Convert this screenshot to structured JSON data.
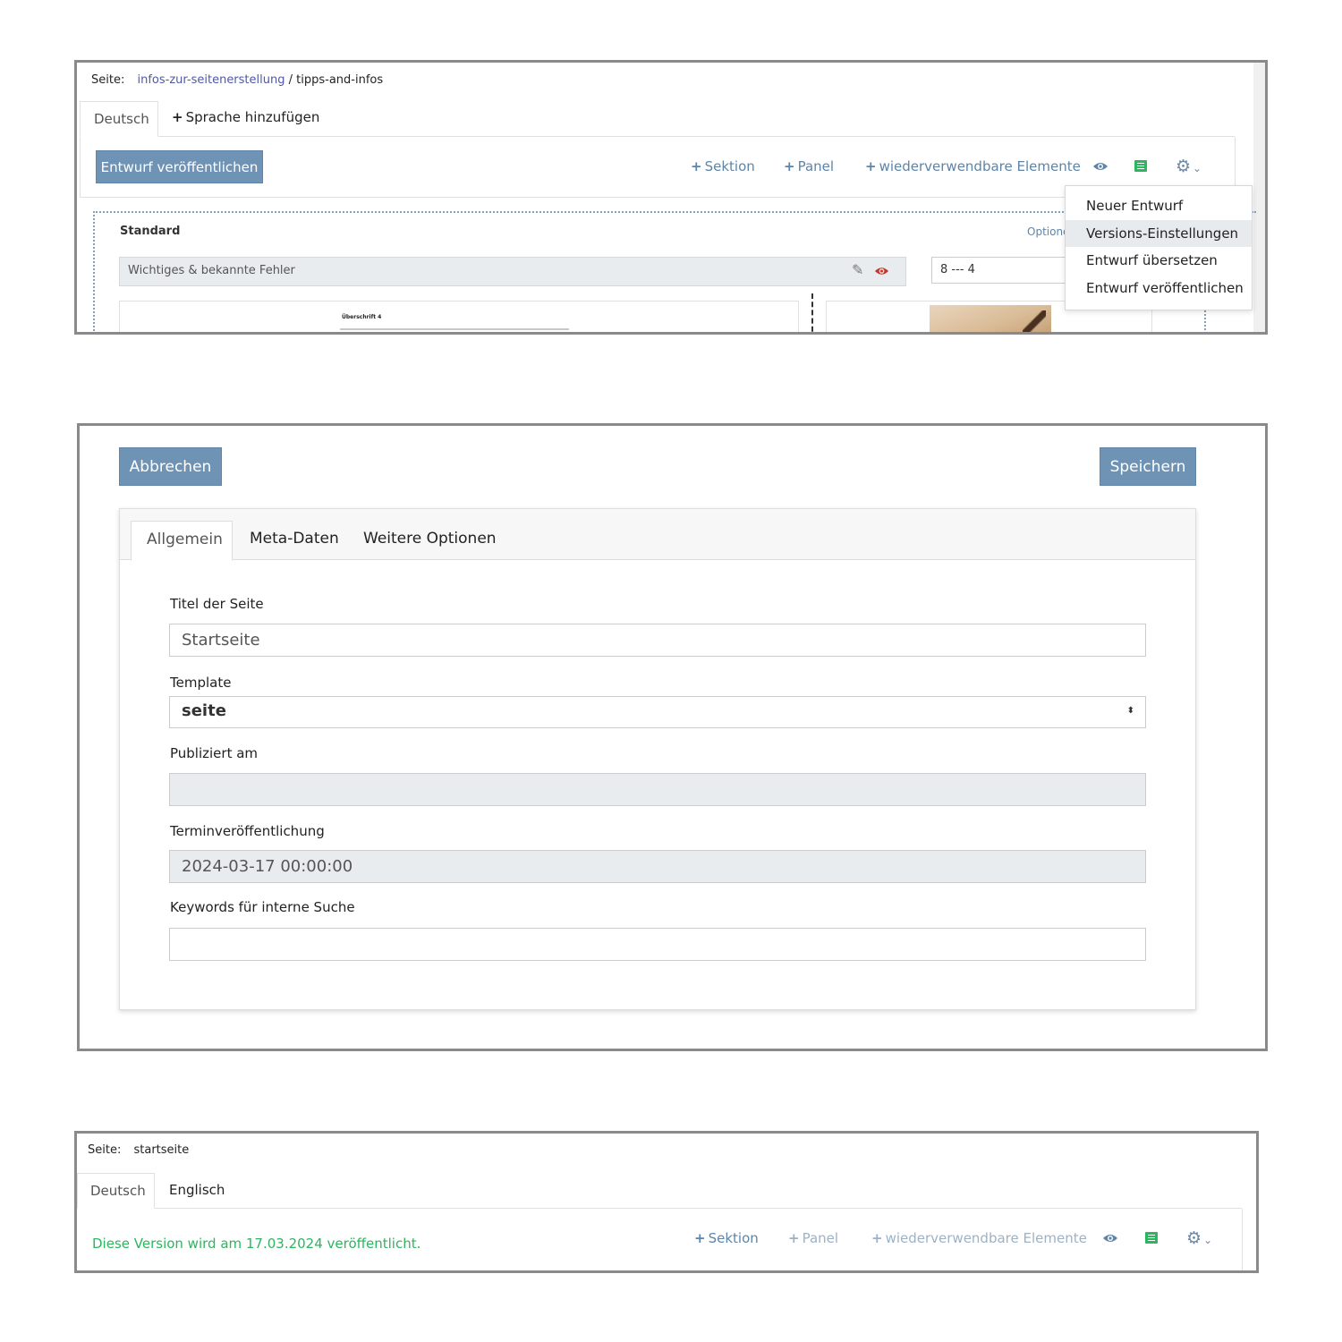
{
  "shot1": {
    "breadcrumb": {
      "label": "Seite:",
      "link": "infos-zur-seitenerstellung",
      "sep": " / ",
      "current": "tipps-and-infos"
    },
    "tabs": {
      "active": "Deutsch",
      "add": "Sprache hinzufügen"
    },
    "publish_button": "Entwurf veröffentlichen",
    "toolbar": {
      "section": "Sektion",
      "panel": "Panel",
      "reusable": "wiederverwendbare Elemente"
    },
    "icons": [
      "eye-icon",
      "list-icon",
      "gear-icon",
      "chevron-down-icon",
      "pencil-icon"
    ],
    "section_label": "Standard",
    "options_label": "Optione",
    "element_title": "Wichtiges & bekannte Fehler",
    "grid_value": "8 --- 4",
    "preview_heading": "Überschrift 4",
    "dropdown": [
      "Neuer Entwurf",
      "Versions-Einstellungen",
      "Entwurf übersetzen",
      "Entwurf veröffentlichen"
    ]
  },
  "shot2": {
    "cancel_button": "Abbrechen",
    "save_button": "Speichern",
    "tabs": [
      "Allgemein",
      "Meta-Daten",
      "Weitere Optionen"
    ],
    "fields": {
      "title": {
        "label": "Titel der Seite",
        "value": "Startseite"
      },
      "template": {
        "label": "Template",
        "value": "seite"
      },
      "published": {
        "label": "Publiziert am",
        "value": ""
      },
      "scheduled": {
        "label": "Terminveröffentlichung",
        "value": "2024-03-17 00:00:00"
      },
      "keywords": {
        "label": "Keywords für interne Suche",
        "value": ""
      }
    }
  },
  "shot3": {
    "breadcrumb": {
      "label": "Seite:",
      "current": "startseite"
    },
    "tabs": [
      "Deutsch",
      "Englisch"
    ],
    "status": "Diese Version wird am 17.03.2024 veröffentlicht.",
    "toolbar": {
      "section": "Sektion",
      "panel": "Panel",
      "reusable": "wiederverwendbare Elemente"
    }
  },
  "colors": {
    "accent_blue": "#6f93b5",
    "link_blue": "#5e84a8",
    "success_green": "#2fb45f",
    "danger_red": "#c0392b"
  }
}
